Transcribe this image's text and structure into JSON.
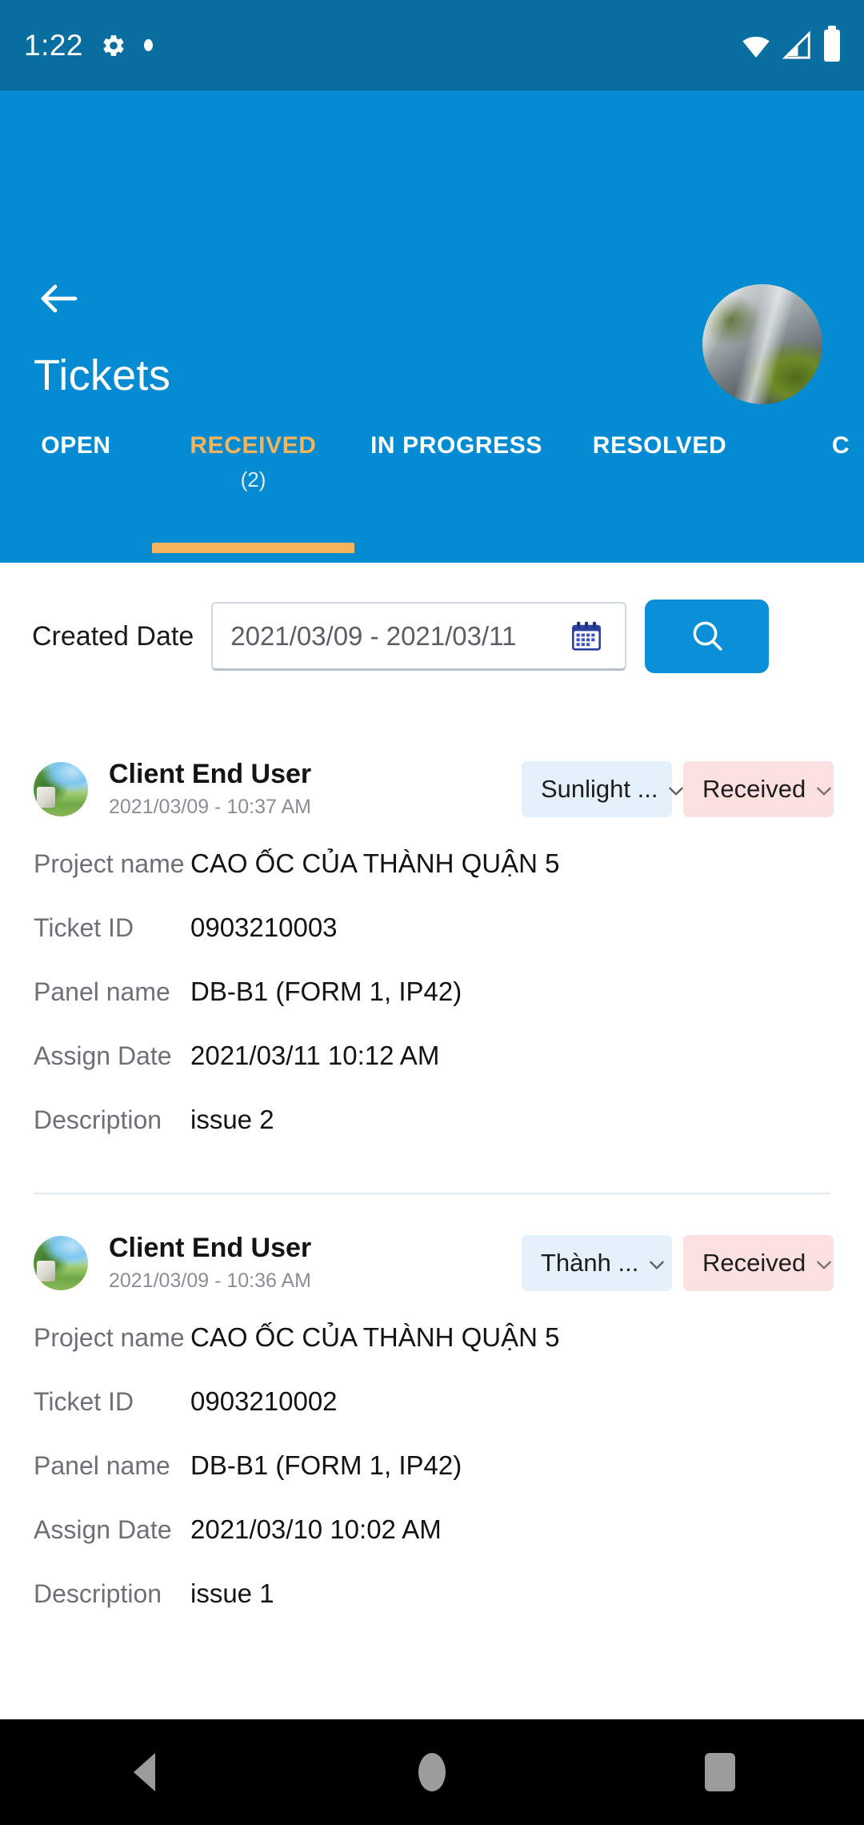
{
  "status_bar": {
    "clock": "1:22",
    "icons": [
      "gear-icon",
      "dot-icon",
      "wifi-icon",
      "cellular-signal-icon",
      "battery-icon"
    ]
  },
  "header": {
    "back_label": "back-arrow-icon",
    "title": "Tickets",
    "avatar_label": "user-avatar"
  },
  "tabs": [
    {
      "label": "OPEN",
      "count": "",
      "active": false
    },
    {
      "label": "RECEIVED",
      "count": "(2)",
      "active": true
    },
    {
      "label": "IN PROGRESS",
      "count": "",
      "active": false
    },
    {
      "label": "RESOLVED",
      "count": "",
      "active": false
    },
    {
      "label": "C",
      "count": "",
      "active": false
    }
  ],
  "filter": {
    "label": "Created Date",
    "date_value": "2021/03/09 - 2021/03/11",
    "calendar_icon": "calendar-icon",
    "search_icon": "search-icon"
  },
  "tickets": [
    {
      "user_name": "Client End User",
      "timestamp": "2021/03/09 - 10:37 AM",
      "project_chip": "Sunlight ...",
      "status_chip": "Received",
      "fields": [
        {
          "key": "Project name",
          "value": "CAO ỐC CỦA THÀNH QUẬN 5"
        },
        {
          "key": "Ticket ID",
          "value": "0903210003"
        },
        {
          "key": "Panel name",
          "value": "DB-B1 (FORM 1, IP42)"
        },
        {
          "key": "Assign Date",
          "value": "2021/03/11 10:12 AM"
        },
        {
          "key": "Description",
          "value": "issue 2"
        }
      ]
    },
    {
      "user_name": "Client End User",
      "timestamp": "2021/03/09 - 10:36 AM",
      "project_chip": "Thành ...",
      "status_chip": "Received",
      "fields": [
        {
          "key": "Project name",
          "value": "CAO ỐC CỦA THÀNH QUẬN 5"
        },
        {
          "key": "Ticket ID",
          "value": "0903210002"
        },
        {
          "key": "Panel name",
          "value": "DB-B1 (FORM 1, IP42)"
        },
        {
          "key": "Assign Date",
          "value": "2021/03/10 10:02 AM"
        },
        {
          "key": "Description",
          "value": "issue 1"
        }
      ]
    }
  ],
  "nav_bar": {
    "back": "nav-back-icon",
    "home": "nav-home-icon",
    "recents": "nav-recents-icon"
  },
  "colors": {
    "status_bar": "#0A6EA0",
    "header": "#058BD2",
    "accent_orange": "#F5B45C",
    "search_button": "#0B8FD8",
    "chip_project": "#E4F0FA",
    "chip_status": "#FBE0E0"
  }
}
